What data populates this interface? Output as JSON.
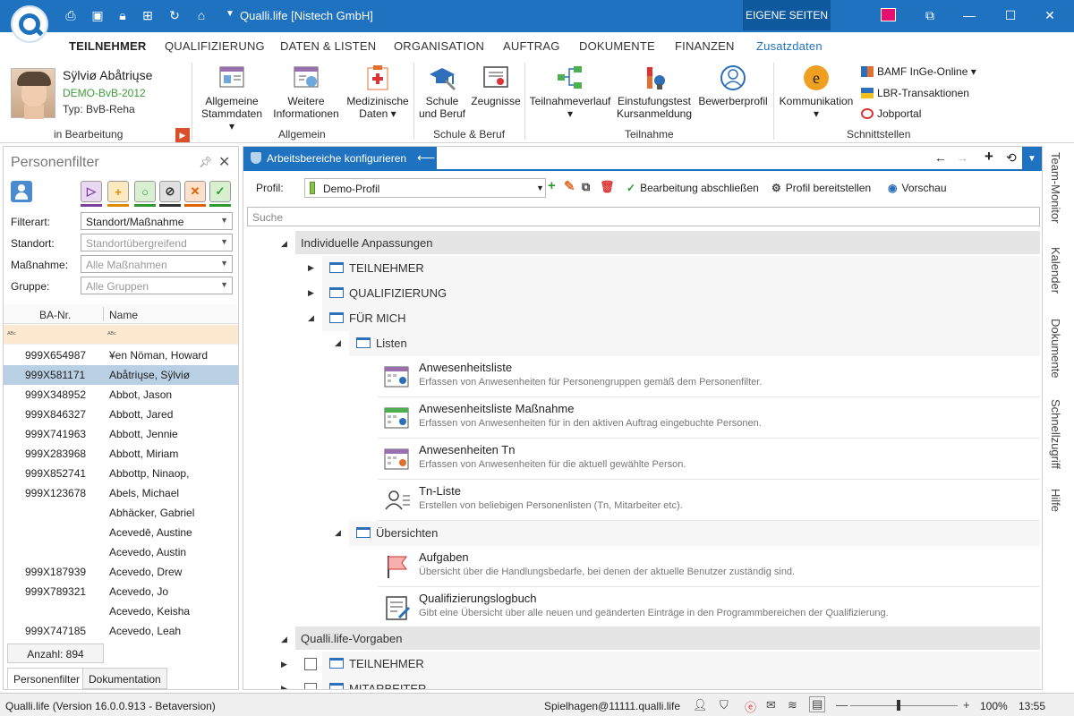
{
  "window": {
    "title": "Qualli.life [Nistech GmbH]",
    "eigene": "EIGENE SEITEN"
  },
  "ribbon_tabs": [
    "TEILNEHMER",
    "QUALIFIZIERUNG",
    "DATEN & LISTEN",
    "ORGANISATION",
    "AUFTRAG",
    "DOKUMENTE",
    "FINANZEN",
    "Zusatzdaten"
  ],
  "person": {
    "name": "Sÿlviø Abåtriųse",
    "group": "DEMO-BvB-2012",
    "typ": "Typ: BvB-Reha",
    "status": "in Bearbeitung"
  },
  "groups": {
    "allgemein": "Allgemein",
    "schule": "Schule & Beruf",
    "teilnahme": "Teilnahme",
    "schnitt": "Schnittstellen"
  },
  "ribbon_buttons": {
    "stamm1": "Allgemeine",
    "stamm2": "Stammdaten",
    "weitere1": "Weitere",
    "weitere2": "Informationen",
    "med1": "Medizinische",
    "med2": "Daten",
    "schule1": "Schule",
    "schule2": "und Beruf",
    "zeug": "Zeugnisse",
    "tv": "Teilnahmeverlauf",
    "einst1": "Einstufungstest",
    "einst2": "Kursanmeldung",
    "bew": "Bewerberprofil",
    "komm": "Kommunikation",
    "bamf": "BAMF InGe-Online",
    "lbr": "LBR-Transaktionen",
    "job": "Jobportal"
  },
  "personenfilter": {
    "title": "Personenfilter",
    "labels": {
      "filterart": "Filterart:",
      "standort": "Standort:",
      "massnahme": "Maßnahme:",
      "gruppe": "Gruppe:"
    },
    "values": {
      "filterart": "Standort/Maßnahme",
      "standort": "Standortübergreifend",
      "massnahme": "Alle Maßnahmen",
      "gruppe": "Alle Gruppen"
    },
    "columns": [
      "BA-Nr.",
      "Name"
    ],
    "rows": [
      {
        "ba": "999X654987",
        "name": "¥en Nöman, Howard"
      },
      {
        "ba": "999X581171",
        "name": "Abåtriųse, Sÿlviø"
      },
      {
        "ba": "999X348952",
        "name": "Abbot, Jason"
      },
      {
        "ba": "999X846327",
        "name": "Abbott, Jared"
      },
      {
        "ba": "999X741963",
        "name": "Abbott, Jennie"
      },
      {
        "ba": "999X283968",
        "name": "Abbott, Miriam"
      },
      {
        "ba": "999X852741",
        "name": "Abbottp, Ninaop,"
      },
      {
        "ba": "999X123678",
        "name": "Abels, Michael"
      },
      {
        "ba": "",
        "name": "Abhäcker, Gabriel"
      },
      {
        "ba": "",
        "name": "Acevedē, Austine"
      },
      {
        "ba": "",
        "name": "Acevedo, Austin"
      },
      {
        "ba": "999X187939",
        "name": "Acevedo, Drew"
      },
      {
        "ba": "999X789321",
        "name": "Acevedo, Jo"
      },
      {
        "ba": "",
        "name": "Acevedo, Keisha"
      },
      {
        "ba": "999X747185",
        "name": "Acevedo, Leah"
      }
    ],
    "count": "Anzahl: 894",
    "tabs": [
      "Personenfilter",
      "Dokumentation"
    ]
  },
  "side_tabs": [
    "Team-Monitor",
    "Kalender",
    "Dokumente",
    "Schnellzugriff",
    "Hilfe"
  ],
  "config": {
    "tab": "Arbeitsbereiche konfigurieren",
    "profil_label": "Profil:",
    "profil_value": "Demo-Profil",
    "actions": [
      "Bearbeitung abschließen",
      "Profil bereitstellen",
      "Vorschau"
    ],
    "search_placeholder": "Suche"
  },
  "tree": {
    "sec1": "Individuelle Anpassungen",
    "sec2": "Qualli.life-Vorgaben",
    "teilnehmer": "TEILNEHMER",
    "qualifizierung": "QUALIFIZIERUNG",
    "fuermich": "FÜR MICH",
    "listen": "Listen",
    "uebersichten": "Übersichten",
    "mitarbeiter": "MITARBEITER",
    "items": [
      {
        "title": "Anwesenheitsliste",
        "desc": "Erfassen von Anwesenheiten für Personengruppen gemäß dem Personenfilter."
      },
      {
        "title": "Anwesenheitsliste Maßnahme",
        "desc": "Erfassen von Anwesenheiten für in den aktiven Auftrag eingebuchte Personen."
      },
      {
        "title": "Anwesenheiten Tn",
        "desc": "Erfassen von Anwesenheiten für die aktuell gewählte Person."
      },
      {
        "title": "Tn-Liste",
        "desc": "Erstellen von beliebigen Personenlisten (Tn, Mitarbeiter etc)."
      },
      {
        "title": "Aufgaben",
        "desc": "Übersicht über die Handlungsbedarfe, bei denen der aktuelle Benutzer zuständig sind."
      },
      {
        "title": "Qualifizierungslogbuch",
        "desc": "Gibt eine Übersicht über alle neuen und geänderten Einträge in den Programmbereichen der Qualifizierung."
      }
    ]
  },
  "status": {
    "version": "Qualli.life (Version 16.0.0.913 - Betaversion)",
    "user": "Spielhagen@11111.qualli.life",
    "zoom": "100%",
    "time": "13:55"
  },
  "colors": {
    "accent": "#1e72bf",
    "selected_row": "#b9cfe3",
    "filter_row": "#fde9cf"
  }
}
